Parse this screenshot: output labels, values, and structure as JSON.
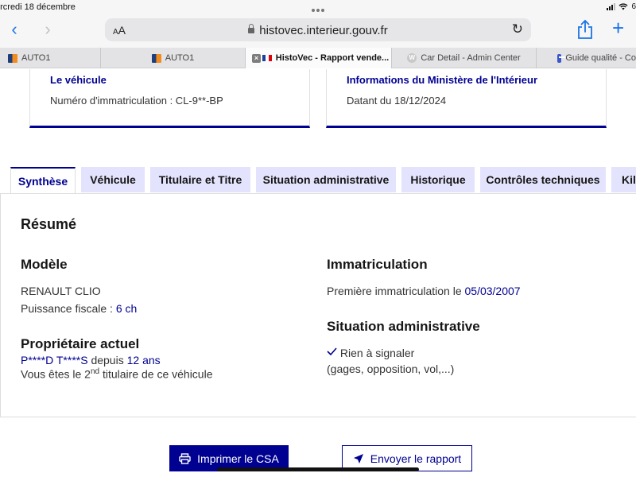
{
  "status": {
    "date": "ercredi 18 décembre",
    "battery": "6"
  },
  "browser": {
    "aa": "AA",
    "url": "histovec.interieur.gouv.fr",
    "tabs": [
      {
        "label": "AUTO1"
      },
      {
        "label": "AUTO1"
      },
      {
        "label": "HistoVec - Rapport vende...",
        "close": "×"
      },
      {
        "label": "Car Detail - Admin Center",
        "fav": "W"
      },
      {
        "label": "Guide qualité - Co"
      }
    ]
  },
  "cards": [
    {
      "title": "Le véhicule",
      "text": "Numéro d'immatriculation : CL-9**-BP"
    },
    {
      "title": "Informations du Ministère de l'Intérieur",
      "text": "Datant du 18/12/2024"
    }
  ],
  "page_tabs": [
    "Synthèse",
    "Véhicule",
    "Titulaire et Titre",
    "Situation administrative",
    "Historique",
    "Contrôles techniques",
    "Kilo"
  ],
  "summary": {
    "title": "Résumé",
    "modele": {
      "heading": "Modèle",
      "value": "RENAULT CLIO",
      "puissance_label": "Puissance fiscale : ",
      "puissance_value": "6 ch"
    },
    "proprietaire": {
      "heading": "Propriétaire actuel",
      "name": "P****D T****S",
      "depuis": " depuis ",
      "duree": "12 ans",
      "rank_prefix": "Vous êtes le 2",
      "rank_sup": "nd",
      "rank_suffix": " titulaire de ce véhicule"
    },
    "immatriculation": {
      "heading": "Immatriculation",
      "label": "Première immatriculation le ",
      "date": "05/03/2007"
    },
    "situation": {
      "heading": "Situation administrative",
      "status": "Rien à signaler",
      "details": "(gages, opposition, vol,...)"
    }
  },
  "buttons": {
    "print": "Imprimer le CSA",
    "send": "Envoyer le rapport"
  },
  "colors": {
    "primary": "#000091",
    "tab_bg": "#e3e3fd",
    "safari_blue": "#1a73e8"
  }
}
